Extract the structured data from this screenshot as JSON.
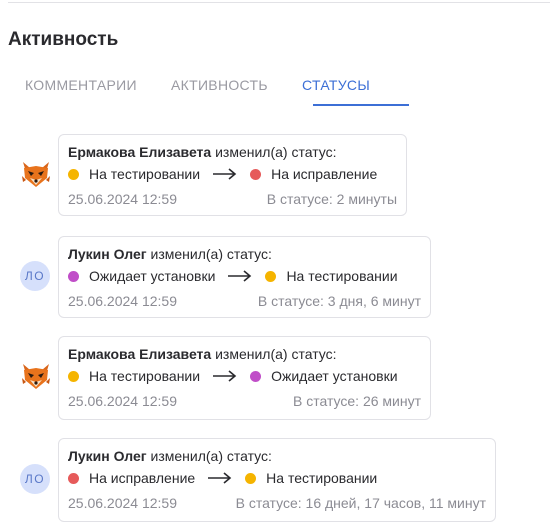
{
  "section_title": "Активность",
  "tabs": [
    {
      "label": "КОММЕНТАРИИ",
      "active": false
    },
    {
      "label": "АКТИВНОСТЬ",
      "active": false
    },
    {
      "label": "СТАТУСЫ",
      "active": true
    }
  ],
  "status_colors": {
    "testing": "#f5b400",
    "fixing": "#e65a5a",
    "awaiting_install": "#c04ec8",
    "accent": "#3c6fd6"
  },
  "entries": [
    {
      "avatar_type": "image",
      "avatar_icon": "fox-avatar-icon",
      "avatar_text": "",
      "user": "Ермакова Елизавета",
      "action": "изменил(а) статус:",
      "from_status": "На тестировании",
      "from_color": "#f5b400",
      "to_status": "На исправление",
      "to_color": "#e65a5a",
      "timestamp": "25.06.2024 12:59",
      "duration": "В статусе: 2 минуты"
    },
    {
      "avatar_type": "initials",
      "avatar_icon": "",
      "avatar_text": "ЛО",
      "user": "Лукин Олег",
      "action": "изменил(а) статус:",
      "from_status": "Ожидает установки",
      "from_color": "#c04ec8",
      "to_status": "На тестировании",
      "to_color": "#f5b400",
      "timestamp": "25.06.2024 12:59",
      "duration": "В статусе: 3 дня, 6 минут"
    },
    {
      "avatar_type": "image",
      "avatar_icon": "fox-avatar-icon",
      "avatar_text": "",
      "user": "Ермакова Елизавета",
      "action": "изменил(а) статус:",
      "from_status": "На тестировании",
      "from_color": "#f5b400",
      "to_status": "Ожидает установки",
      "to_color": "#c04ec8",
      "timestamp": "25.06.2024 12:59",
      "duration": "В статусе: 26 минут"
    },
    {
      "avatar_type": "initials",
      "avatar_icon": "",
      "avatar_text": "ЛО",
      "user": "Лукин Олег",
      "action": "изменил(а) статус:",
      "from_status": "На исправление",
      "from_color": "#e65a5a",
      "to_status": "На тестировании",
      "to_color": "#f5b400",
      "timestamp": "25.06.2024 12:59",
      "duration": "В статусе: 16 дней, 17 часов, 11 минут"
    }
  ]
}
